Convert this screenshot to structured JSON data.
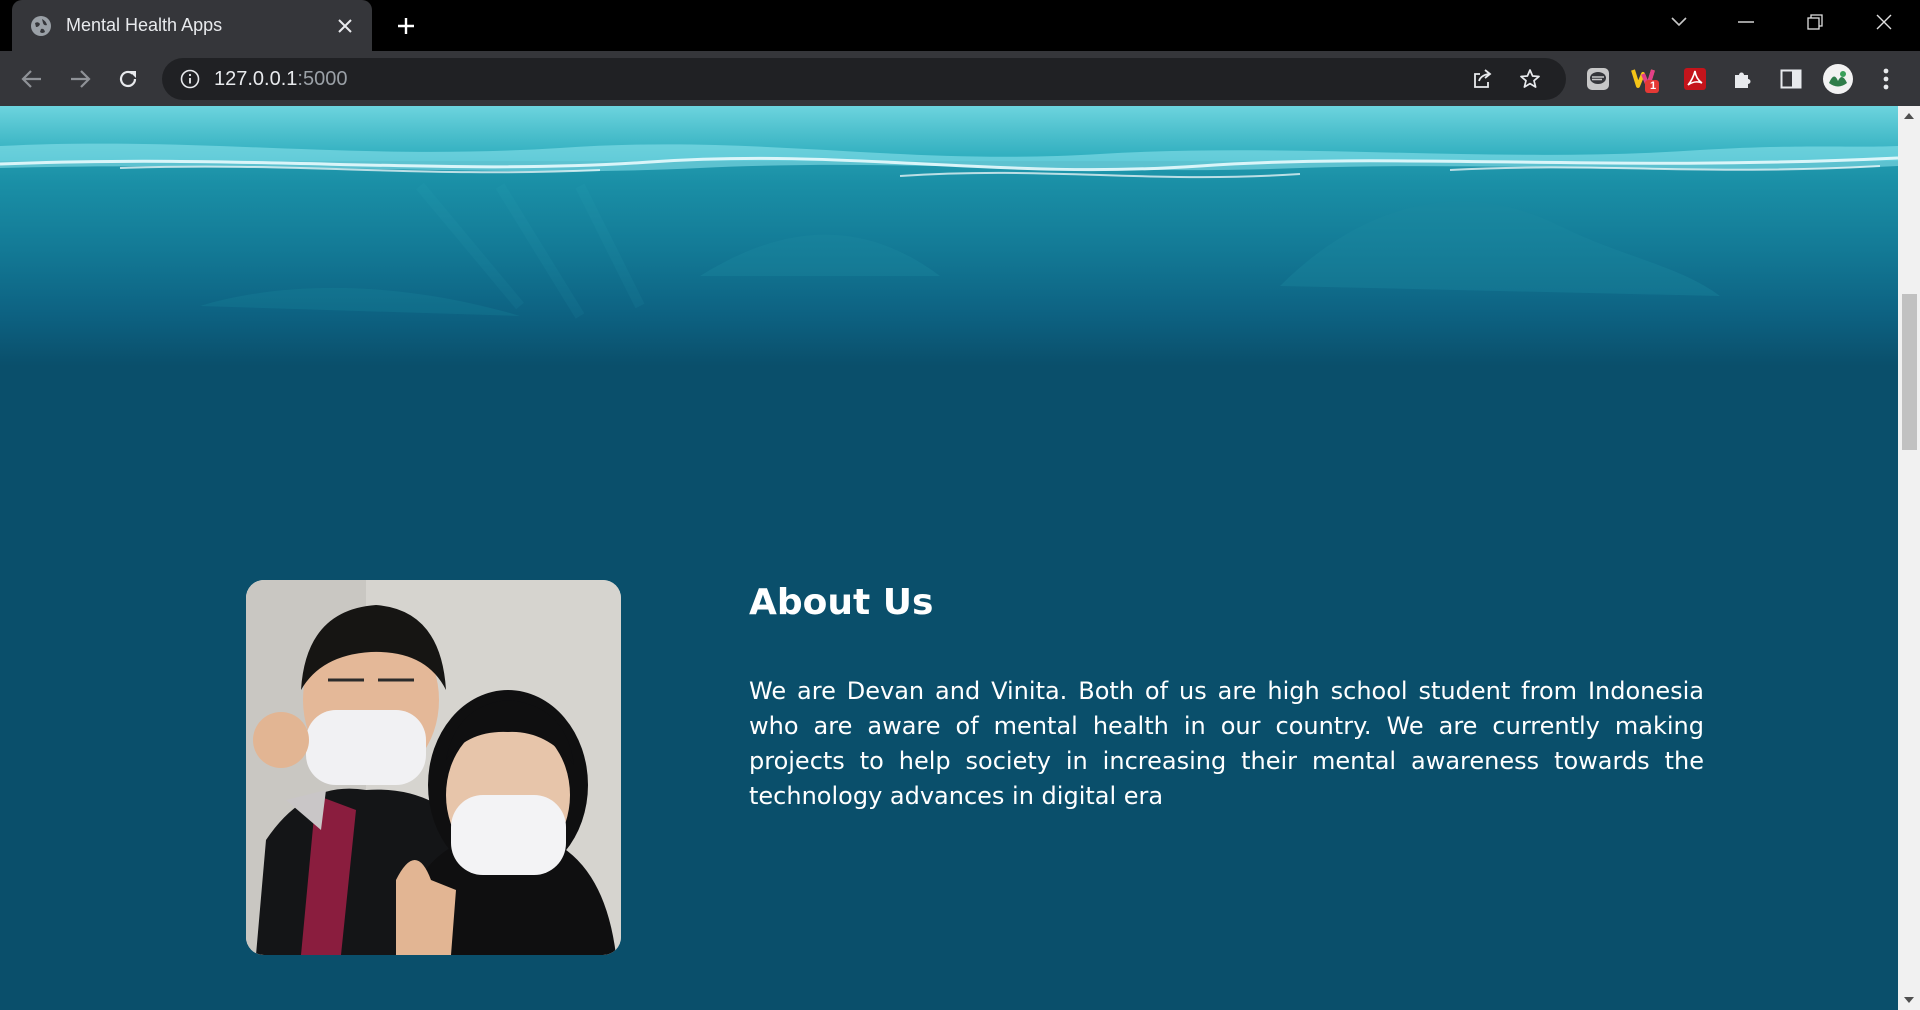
{
  "browser": {
    "tab_title": "Mental Health Apps",
    "url_host": "127.0.0.1",
    "url_port": ":5000"
  },
  "extensions": {
    "badge_count": "1"
  },
  "about": {
    "title": "About Us",
    "text": "We are Devan and Vinita. Both of us are high school student from Indonesia who are aware of mental health in our country. We are currently making projects to help society in increasing their mental awareness towards the technology advances in digital era"
  },
  "colors": {
    "page_background": "#0a4f6b",
    "ocean_surface": "#35b9c6",
    "text": "#ffffff"
  }
}
